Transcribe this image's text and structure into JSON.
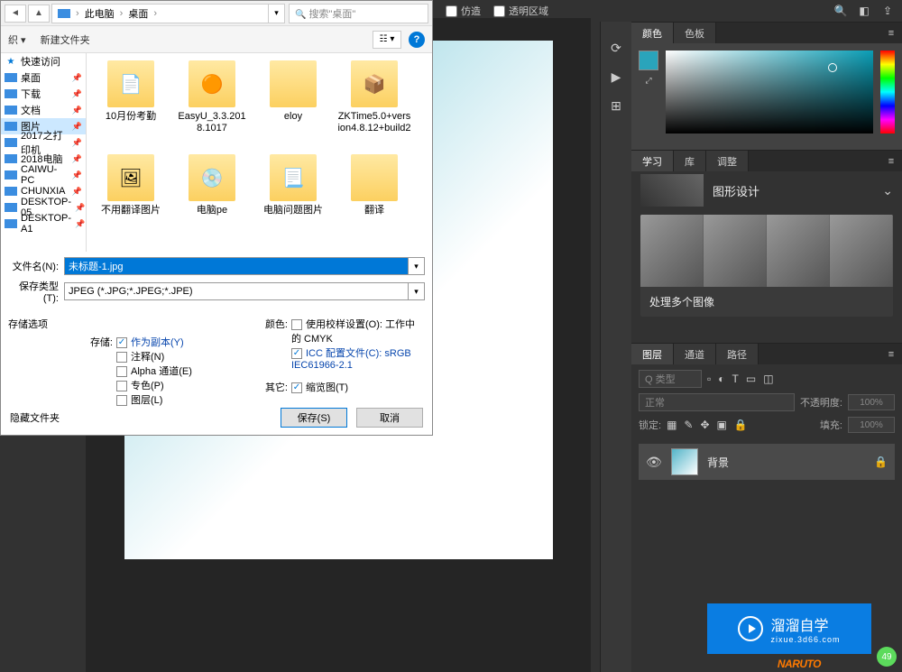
{
  "topbar": {
    "item1": "仿造",
    "item2": "透明区域",
    "icons": [
      "search",
      "layout",
      "share"
    ]
  },
  "dialog": {
    "breadcrumb": {
      "part1": "此电脑",
      "part2": "桌面"
    },
    "search_placeholder": "搜索\"桌面\"",
    "toolbar": {
      "organize": "织 ▾",
      "new_folder": "新建文件夹"
    },
    "sidebar": {
      "quick": "快速访问",
      "items": [
        {
          "label": "桌面"
        },
        {
          "label": "下载"
        },
        {
          "label": "文档"
        },
        {
          "label": "图片"
        },
        {
          "label": "2017之打印机"
        },
        {
          "label": "2018电脑"
        },
        {
          "label": "CAIWU-PC"
        },
        {
          "label": "CHUNXIA"
        },
        {
          "label": "DESKTOP-05"
        },
        {
          "label": "DESKTOP-A1"
        }
      ]
    },
    "files": [
      {
        "label": "10月份考勤",
        "icon": "📄"
      },
      {
        "label": "EasyU_3.3.2018.1017",
        "icon": "🟠"
      },
      {
        "label": "eloy",
        "icon": ""
      },
      {
        "label": "ZKTime5.0+version4.8.12+build2",
        "icon": "📦"
      },
      {
        "label": "不用翻译图片",
        "icon": "🖼"
      },
      {
        "label": "电脑pe",
        "icon": "💿"
      },
      {
        "label": "电脑问题图片",
        "icon": "📃"
      },
      {
        "label": "翻译",
        "icon": ""
      }
    ],
    "filename_label": "文件名(N):",
    "filename_value": "未标题-1.jpg",
    "filetype_label": "保存类型(T):",
    "filetype_value": "JPEG (*.JPG;*.JPEG;*.JPE)",
    "options_header": "存储选项",
    "store_label": "存储:",
    "as_copy": "作为副本(Y)",
    "annotations": "注释(N)",
    "alpha": "Alpha 通道(E)",
    "spot": "专色(P)",
    "layers": "图层(L)",
    "color_label": "颜色:",
    "proof_setup": "使用校样设置(O): 工作中的 CMYK",
    "icc_profile": "ICC 配置文件(C): sRGB IEC61966-2.1",
    "other_label": "其它:",
    "thumbnail": "缩览图(T)",
    "hide_ext": "隐藏文件夹",
    "save_btn": "保存(S)",
    "cancel_btn": "取消"
  },
  "colorPanel": {
    "tab_color": "颜色",
    "tab_swatches": "色板",
    "fg_color": "#2aa4bb"
  },
  "learnPanel": {
    "tabs": {
      "learn": "学习",
      "library": "库",
      "adjust": "调整"
    },
    "section_title": "图形设计",
    "card_caption": "处理多个图像"
  },
  "layersPanel": {
    "tabs": {
      "layers": "图层",
      "channels": "通道",
      "paths": "路径"
    },
    "kind_label": "Q 类型",
    "blend_mode": "正常",
    "opacity_label": "不透明度:",
    "opacity_value": "100%",
    "lock_label": "锁定:",
    "fill_label": "填充:",
    "fill_value": "100%",
    "layer_name": "背景"
  },
  "watermark": {
    "text": "溜溜自学",
    "sub": "zixue.3d66.com"
  },
  "naruto": "NARUTO",
  "badge": "49"
}
